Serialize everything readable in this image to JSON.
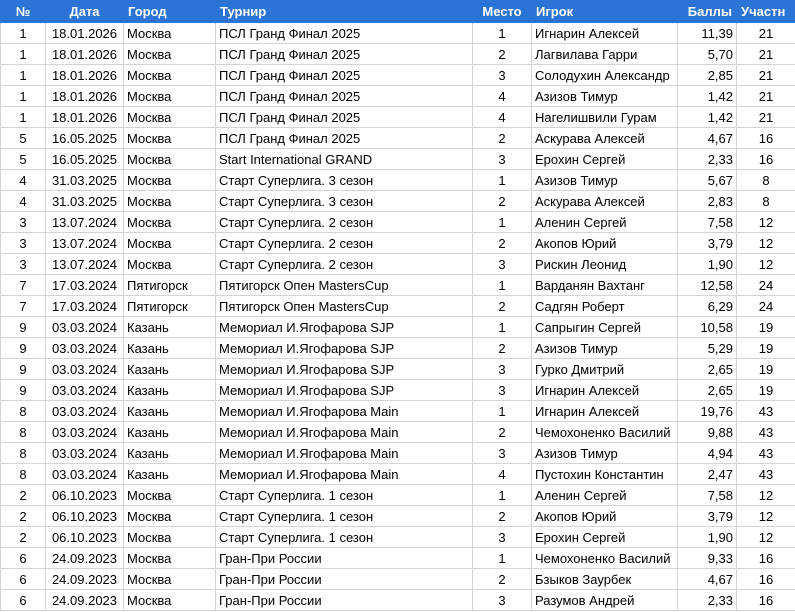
{
  "table": {
    "headers": [
      "№",
      "Дата",
      "Город",
      "Турнир",
      "Место",
      "Игрок",
      "Баллы",
      "Участн"
    ],
    "rows": [
      [
        "1",
        "18.01.2026",
        "Москва",
        "ПСЛ Гранд Финал 2025",
        "1",
        "Игнарин Алексей",
        "11,39",
        "21"
      ],
      [
        "1",
        "18.01.2026",
        "Москва",
        "ПСЛ Гранд Финал 2025",
        "2",
        "Лагвилава Гарри",
        "5,70",
        "21"
      ],
      [
        "1",
        "18.01.2026",
        "Москва",
        "ПСЛ Гранд Финал 2025",
        "3",
        "Солодухин Александр",
        "2,85",
        "21"
      ],
      [
        "1",
        "18.01.2026",
        "Москва",
        "ПСЛ Гранд Финал 2025",
        "4",
        "Азизов Тимур",
        "1,42",
        "21"
      ],
      [
        "1",
        "18.01.2026",
        "Москва",
        "ПСЛ Гранд Финал 2025",
        "4",
        "Нагелишвили Гурам",
        "1,42",
        "21"
      ],
      [
        "5",
        "16.05.2025",
        "Москва",
        "ПСЛ Гранд Финал 2025",
        "2",
        "Аскурава Алексей",
        "4,67",
        "16"
      ],
      [
        "5",
        "16.05.2025",
        "Москва",
        "Start International GRAND",
        "3",
        "Ерохин Сергей",
        "2,33",
        "16"
      ],
      [
        "4",
        "31.03.2025",
        "Москва",
        "Старт Суперлига. 3 сезон",
        "1",
        "Азизов Тимур",
        "5,67",
        "8"
      ],
      [
        "4",
        "31.03.2025",
        "Москва",
        "Старт Суперлига. 3 сезон",
        "2",
        "Аскурава Алексей",
        "2,83",
        "8"
      ],
      [
        "3",
        "13.07.2024",
        "Москва",
        "Старт Суперлига. 2 сезон",
        "1",
        "Аленин Сергей",
        "7,58",
        "12"
      ],
      [
        "3",
        "13.07.2024",
        "Москва",
        "Старт Суперлига. 2 сезон",
        "2",
        "Акопов Юрий",
        "3,79",
        "12"
      ],
      [
        "3",
        "13.07.2024",
        "Москва",
        "Старт Суперлига. 2 сезон",
        "3",
        "Рискин Леонид",
        "1,90",
        "12"
      ],
      [
        "7",
        "17.03.2024",
        "Пятигорск",
        "Пятигорск Опен MastersCup",
        "1",
        "Варданян Вахтанг",
        "12,58",
        "24"
      ],
      [
        "7",
        "17.03.2024",
        "Пятигорск",
        "Пятигорск Опен MastersCup",
        "2",
        "Садгян Роберт",
        "6,29",
        "24"
      ],
      [
        "9",
        "03.03.2024",
        "Казань",
        "Мемориал И.Ягофарова SJP",
        "1",
        "Сапрыгин Сергей",
        "10,58",
        "19"
      ],
      [
        "9",
        "03.03.2024",
        "Казань",
        "Мемориал И.Ягофарова SJP",
        "2",
        "Азизов Тимур",
        "5,29",
        "19"
      ],
      [
        "9",
        "03.03.2024",
        "Казань",
        "Мемориал И.Ягофарова SJP",
        "3",
        "Гурко Дмитрий",
        "2,65",
        "19"
      ],
      [
        "9",
        "03.03.2024",
        "Казань",
        "Мемориал И.Ягофарова SJP",
        "3",
        "Игнарин Алексей",
        "2,65",
        "19"
      ],
      [
        "8",
        "03.03.2024",
        "Казань",
        "Мемориал И.Ягофарова Main",
        "1",
        "Игнарин Алексей",
        "19,76",
        "43"
      ],
      [
        "8",
        "03.03.2024",
        "Казань",
        "Мемориал И.Ягофарова Main",
        "2",
        "Чемохоненко Василий",
        "9,88",
        "43"
      ],
      [
        "8",
        "03.03.2024",
        "Казань",
        "Мемориал И.Ягофарова Main",
        "3",
        "Азизов Тимур",
        "4,94",
        "43"
      ],
      [
        "8",
        "03.03.2024",
        "Казань",
        "Мемориал И.Ягофарова Main",
        "4",
        "Пустохин Константин",
        "2,47",
        "43"
      ],
      [
        "2",
        "06.10.2023",
        "Москва",
        "Старт Суперлига. 1 сезон",
        "1",
        "Аленин Сергей",
        "7,58",
        "12"
      ],
      [
        "2",
        "06.10.2023",
        "Москва",
        "Старт Суперлига. 1 сезон",
        "2",
        "Акопов Юрий",
        "3,79",
        "12"
      ],
      [
        "2",
        "06.10.2023",
        "Москва",
        "Старт Суперлига. 1 сезон",
        "3",
        "Ерохин Сергей",
        "1,90",
        "12"
      ],
      [
        "6",
        "24.09.2023",
        "Москва",
        "Гран-При России",
        "1",
        "Чемохоненко Василий",
        "9,33",
        "16"
      ],
      [
        "6",
        "24.09.2023",
        "Москва",
        "Гран-При России",
        "2",
        "Бзыков Заурбек",
        "4,67",
        "16"
      ],
      [
        "6",
        "24.09.2023",
        "Москва",
        "Гран-При России",
        "3",
        "Разумов Андрей",
        "2,33",
        "16"
      ]
    ]
  }
}
